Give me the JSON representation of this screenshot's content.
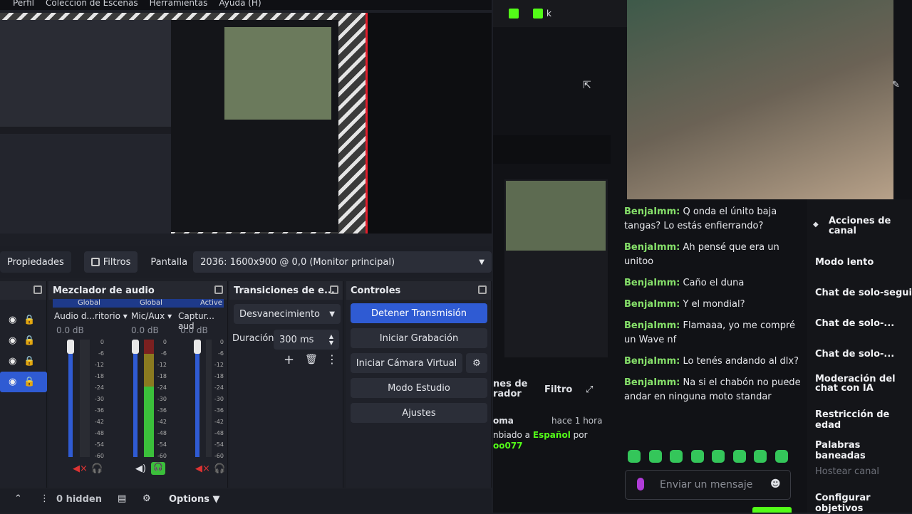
{
  "menu": [
    "Perfil",
    "Colección de Escenas",
    "Herramientas",
    "Ayuda (H)"
  ],
  "propbar": {
    "properties": "Propiedades",
    "filters": "Filtros",
    "display_label": "Pantalla",
    "display_value": "2036: 1600x900 @ 0,0 (Monitor principal)"
  },
  "mixer": {
    "title": "Mezclador de audio",
    "channels": [
      {
        "badge": "Global",
        "name": "Audio d...ritorio",
        "db": "0.0 dB"
      },
      {
        "badge": "Global",
        "name": "Mic/Aux",
        "db": "0.0 dB"
      },
      {
        "badge": "Active",
        "name": "Captur... aud",
        "db": "0.0 dB"
      }
    ],
    "scale": [
      "0",
      "-6",
      "-12",
      "-18",
      "-24",
      "-30",
      "-36",
      "-42",
      "-48",
      "-54",
      "-60"
    ]
  },
  "transitions": {
    "title": "Transiciones de e...",
    "type": "Desvanecimiento",
    "duration_label": "Duración",
    "duration_value": "300 ms"
  },
  "controls": {
    "title": "Controles",
    "stop_stream": "Detener Transmisión",
    "start_recording": "Iniciar Grabación",
    "start_virtualcam": "Iniciar Cámara Virtual",
    "studio_mode": "Modo Estudio",
    "settings": "Ajustes"
  },
  "bottom": {
    "hidden": "0 hidden",
    "options": "Options"
  },
  "right_top": {
    "tab_label": "k"
  },
  "mod_panel": {
    "title_part": "nes de\nrador",
    "filter": "Filtro",
    "entry_user": "oma",
    "entry_time": "hace 1 hora",
    "entry_change": "nbiado a",
    "entry_lang": "Español",
    "entry_by": "por",
    "entry_mod": "oo077"
  },
  "chat": {
    "messages": [
      {
        "user": "BenjaImm:",
        "text": "Q onda el únito baja tangas? Lo estás enfierrando?"
      },
      {
        "user": "BenjaImm:",
        "text": "Ah pensé que era un unitoo"
      },
      {
        "user": "BenjaImm:",
        "text": "Caño el duna"
      },
      {
        "user": "BenjaImm:",
        "text": "Y el mondial?"
      },
      {
        "user": "BenjaImm:",
        "text": "Flamaaa, yo me compré un Wave nf"
      },
      {
        "user": "BenjaImm:",
        "text": "Lo tenés andando al dlx?"
      },
      {
        "user": "BenjaImm:",
        "text": "Na si el chabón no puede andar en ninguna moto standar"
      }
    ],
    "placeholder": "Enviar un mensaje"
  },
  "actions": {
    "title": "Acciones de canal",
    "items": [
      "Modo lento",
      "Chat de solo-seguido",
      "Chat de solo-...",
      "Chat de solo-...",
      "Moderación del chat con IA",
      "Restricción de edad",
      "Palabras baneadas",
      "Hostear canal",
      "Configurar objetivos"
    ]
  },
  "colors": {
    "accent": "#2f5bd3",
    "chat_user": "#86e06a",
    "kick_green": "#53fc18"
  }
}
